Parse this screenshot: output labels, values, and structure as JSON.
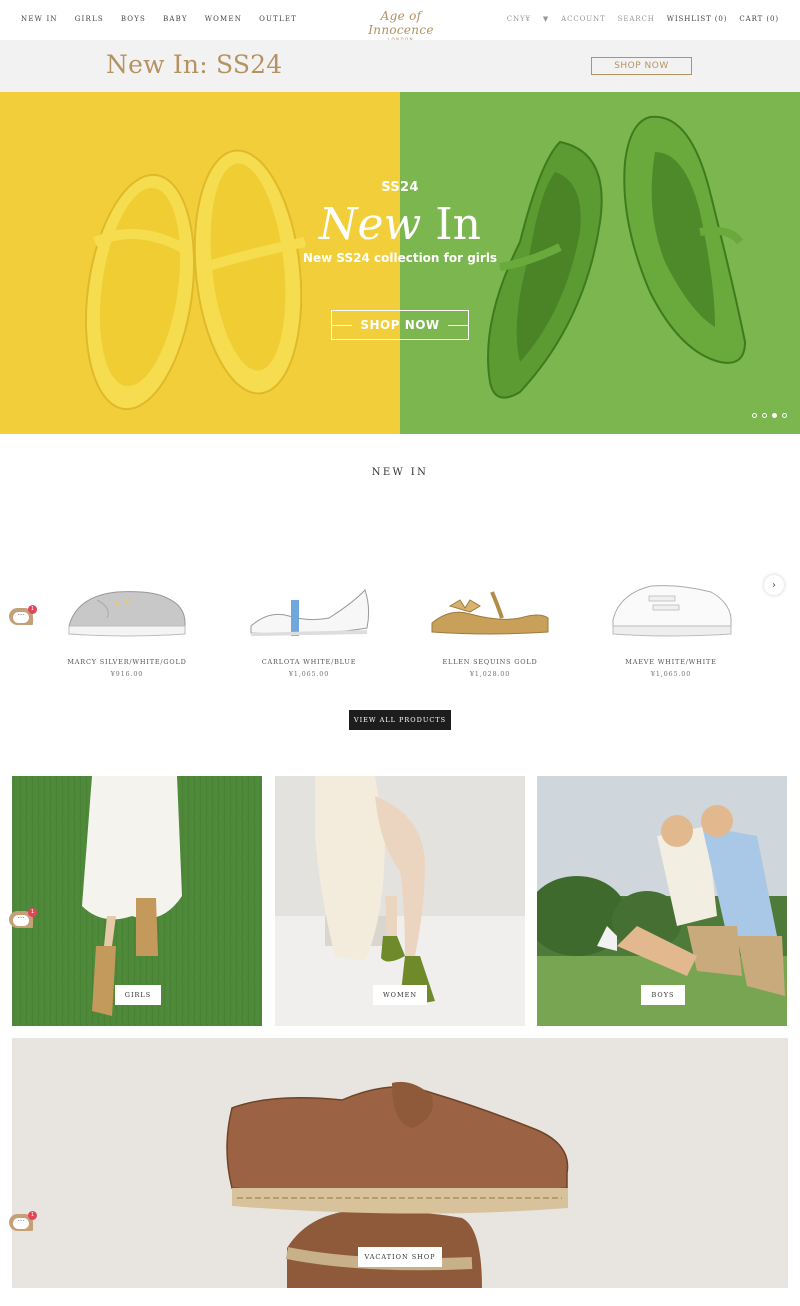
{
  "nav": {
    "left_items": [
      "NEW IN",
      "GIRLS",
      "BOYS",
      "BABY",
      "WOMEN",
      "OUTLET"
    ],
    "logo_script": "Age of Innocence",
    "logo_sub": "LONDON",
    "currency": "CNY¥",
    "account": "ACCOUNT",
    "search": "SEARCH",
    "wishlist": "WISHLIST (0)",
    "cart": "CART (0)"
  },
  "promo": {
    "title": "New In: SS24",
    "button": "SHOP NOW",
    "accent_color": "#b59361"
  },
  "hero": {
    "eyebrow": "SS24",
    "headline_italic": "New",
    "headline_rest": " In",
    "subtitle": "New SS24 collection for girls",
    "button": "SHOP NOW",
    "left_color": "#f2cf3a",
    "right_color": "#7cb64e",
    "active_slide": 3,
    "slide_count": 4
  },
  "new_in": {
    "title": "NEW IN",
    "products": [
      {
        "name": "MARCY SILVER/WHITE/GOLD",
        "price": "¥916.00"
      },
      {
        "name": "CARLOTA WHITE/BLUE",
        "price": "¥1,065.00"
      },
      {
        "name": "ELLEN SEQUINS GOLD",
        "price": "¥1,028.00"
      },
      {
        "name": "MAEVE WHITE/WHITE",
        "price": "¥1,065.00"
      }
    ],
    "view_all": "VIEW ALL PRODUCTS"
  },
  "categories": [
    {
      "label": "GIRLS"
    },
    {
      "label": "WOMEN"
    },
    {
      "label": "BOYS"
    }
  ],
  "vacation": {
    "label": "VACATION SHOP"
  },
  "chat": {
    "badge": "1",
    "dots": "···"
  }
}
